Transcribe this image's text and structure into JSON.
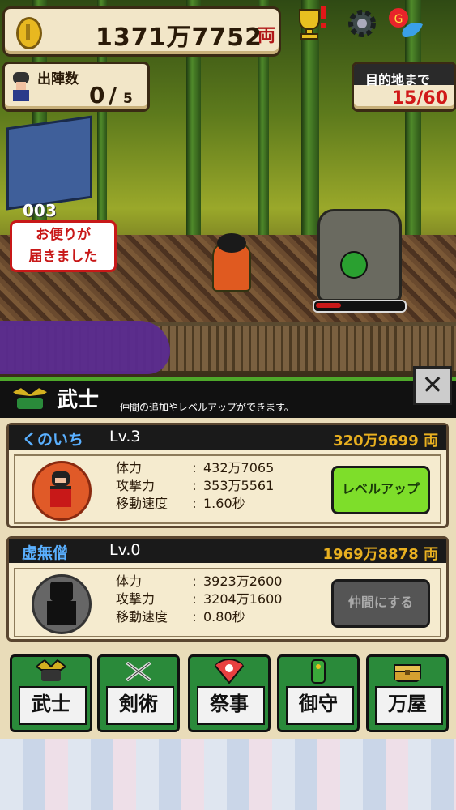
{
  "hud": {
    "money_value": "1371万7752",
    "money_unit": "両",
    "sortie_label": "出陣数",
    "sortie_current": "0",
    "sortie_slash": "/",
    "sortie_max": "5",
    "destination_label": "目的地まで",
    "destination_value": "15/60"
  },
  "scene": {
    "mail_count": "003",
    "mail_line1": "お便りが",
    "mail_line2": "届きました",
    "enemy_hp_fraction": 0.3
  },
  "panel": {
    "title": "武士",
    "subtitle": "仲間の追加やレベルアップができます。",
    "close_glyph": "✕"
  },
  "cards": [
    {
      "name": "くのいち",
      "level": "Lv.3",
      "price": "320万9699 両",
      "stats": [
        {
          "label": "体力",
          "value": "432万7065"
        },
        {
          "label": "攻撃力",
          "value": "353万5561"
        },
        {
          "label": "移動速度",
          "value": "1.60秒"
        }
      ],
      "button": "レベルアップ"
    },
    {
      "name": "虚無僧",
      "level": "Lv.0",
      "price": "1969万8878 両",
      "stats": [
        {
          "label": "体力",
          "value": "3923万2600"
        },
        {
          "label": "攻撃力",
          "value": "3204万1600"
        },
        {
          "label": "移動速度",
          "value": "0.80秒"
        }
      ],
      "button": "仲間にする"
    }
  ],
  "nav": [
    {
      "label": "武士",
      "icon": "helmet-icon"
    },
    {
      "label": "剣術",
      "icon": "crossed-swords-icon"
    },
    {
      "label": "祭事",
      "icon": "fan-icon"
    },
    {
      "label": "御守",
      "icon": "charm-icon"
    },
    {
      "label": "万屋",
      "icon": "chest-icon"
    }
  ],
  "colors": {
    "accent_green": "#7ede2a",
    "price_gold": "#e8b020",
    "name_blue": "#5ab0ff",
    "alert_red": "#d01818"
  }
}
